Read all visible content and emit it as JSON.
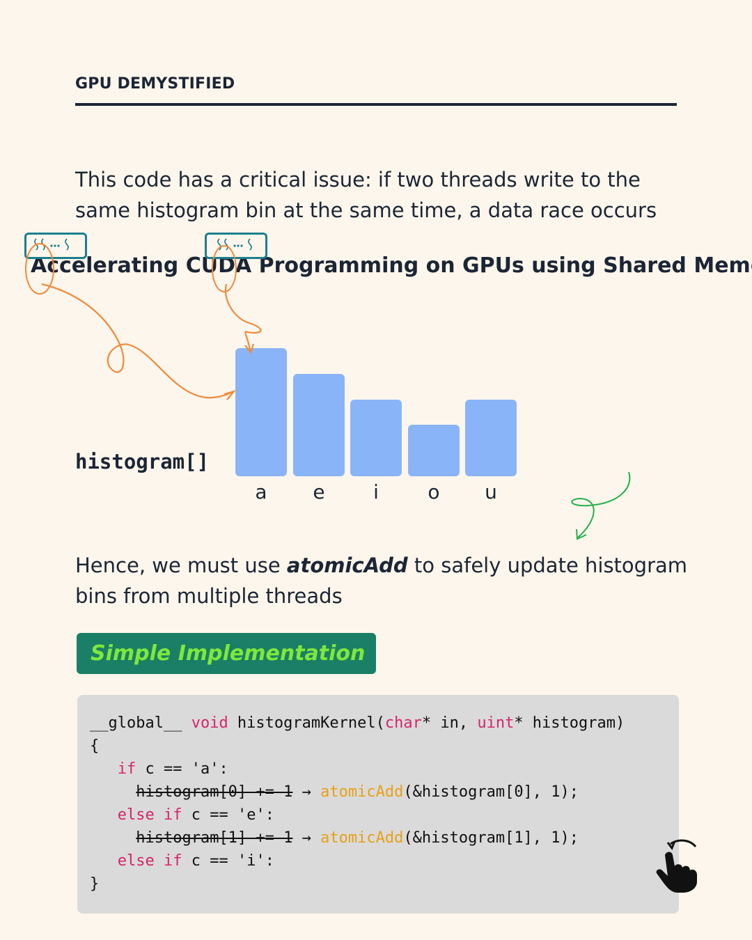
{
  "header": {
    "section": "GPU DEMYSTIFIED"
  },
  "intro": "This code has a critical issue: if two threads write to the same histogram bin at the same time, a data race occurs",
  "title": "Accelerating CUDA Programming on GPUs using Shared Memory",
  "histogram": {
    "label": "histogram[]",
    "bins": [
      {
        "label": "a",
        "value": 1.0
      },
      {
        "label": "e",
        "value": 0.8
      },
      {
        "label": "i",
        "value": 0.6
      },
      {
        "label": "o",
        "value": 0.4
      },
      {
        "label": "u",
        "value": 0.6
      }
    ],
    "bar_color": "#8ab4f8"
  },
  "hence": {
    "before": "Hence, we must use ",
    "emphasis": "atomicAdd",
    "after": " to safely update histogram bins from multiple threads"
  },
  "impl_label": "Simple Implementation",
  "code": {
    "line1": {
      "a": "__global__ ",
      "kw1": "void",
      "b": " histogramKernel(",
      "kw2": "char",
      "c": "* in, ",
      "kw3": "uint",
      "d": "* histogram)"
    },
    "line2": "{",
    "line3": {
      "kw": "if",
      "rest": " c == 'a':"
    },
    "line4": {
      "struck": "histogram[0] += 1",
      "arrow": " → ",
      "fn": "atomicAdd",
      "rest": "(&histogram[0], 1);"
    },
    "line5": {
      "kw1": "else",
      "kw2": "if",
      "rest": " c == 'e':"
    },
    "line6": {
      "struck": "histogram[1] += 1",
      "arrow": " → ",
      "fn": "atomicAdd",
      "rest": "(&histogram[1], 1);"
    },
    "line7": {
      "kw1": "else",
      "kw2": "if",
      "rest": " c == 'i':"
    },
    "line8": "}"
  },
  "colors": {
    "background": "#fdf6ec",
    "text": "#1b2535",
    "keyword": "#d4256b",
    "function": "#e6a117",
    "impl_bg": "#1a7f66",
    "impl_text": "#7ee83b",
    "arrow_orange": "#f08a3c",
    "arrow_green": "#22b04b",
    "chip_border": "#1b7f8f"
  },
  "icons": [
    "thread-group-icon",
    "pointing-hand-icon"
  ]
}
